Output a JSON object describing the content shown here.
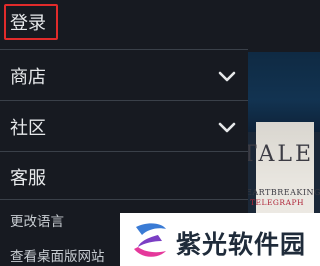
{
  "menu": {
    "login_label": "登录",
    "items": [
      {
        "label": "商店",
        "icon": "chevron-down-icon"
      },
      {
        "label": "社区",
        "icon": "chevron-down-icon"
      },
      {
        "label": "客服"
      }
    ],
    "links": [
      {
        "label": "更改语言"
      },
      {
        "label": "查看桌面版网站"
      }
    ]
  },
  "background": {
    "book_title": "TALE",
    "book_subtitle": "EARTBREAKING",
    "book_publisher": "TELEGRAPH"
  },
  "watermark": {
    "text": "紫光软件园",
    "icon": "zi-guang-logo-icon"
  },
  "colors": {
    "menu_bg": "#171a21",
    "divider": "#3a4049",
    "login_highlight": "#e12b2b",
    "text": "#e6e8ea"
  }
}
